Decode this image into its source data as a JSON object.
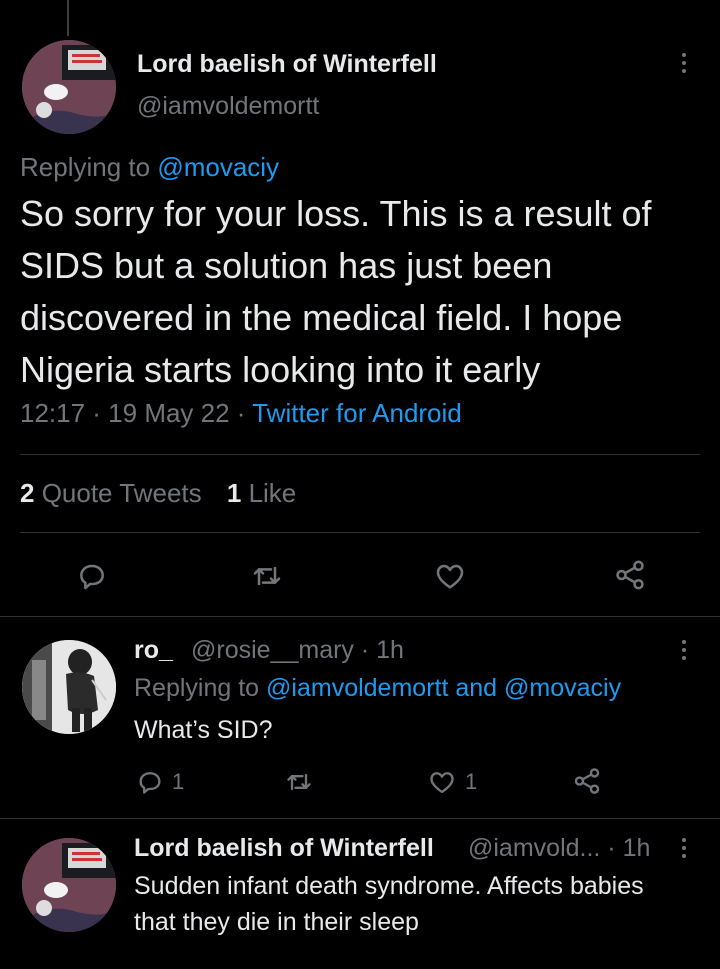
{
  "main_tweet": {
    "name": "Lord baelish of Winterfell",
    "handle": "@iamvoldemortt",
    "replying_prefix": "Replying to ",
    "replying_to": "@movaciy",
    "text": "So sorry for your loss. This is a result of SIDS but a solution has just been discovered in the medical field. I hope Nigeria starts looking into it early",
    "time": "12:17 · 19 May 22 · ",
    "source": "Twitter for Android",
    "quote_count": "2",
    "quote_label": " Quote Tweets",
    "like_count": "1",
    "like_label": " Like"
  },
  "replies": [
    {
      "name": "ro_",
      "handle_time": "@rosie__mary · 1h",
      "replying_prefix": "Replying to ",
      "replying_to": "@iamvoldemortt and @movaciy",
      "text": "What’s SID?",
      "reply_count": "1",
      "retweet_count": "",
      "like_count": "1"
    },
    {
      "name": "Lord baelish of Winterfell",
      "handle_time": "@iamvold... · 1h",
      "text": "Sudden infant death syndrome. Affects babies that they die in their sleep"
    }
  ],
  "colors": {
    "background": "#000000",
    "text": "#e7e9ea",
    "muted": "#71767b",
    "link": "#1d9bf0",
    "divider": "#2f3336"
  },
  "icons": [
    "more-icon",
    "reply-icon",
    "retweet-icon",
    "like-icon",
    "share-icon"
  ]
}
